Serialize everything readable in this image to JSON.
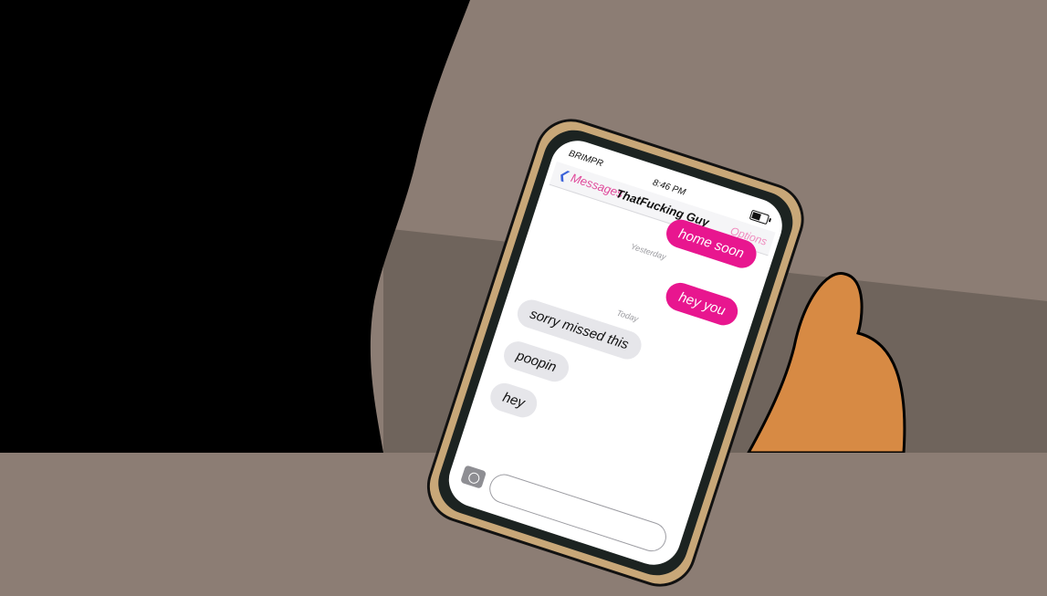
{
  "phone": {
    "carrier": "BRIMPR",
    "time": "8:46 PM",
    "nav": {
      "back_chevron": "❮",
      "back_label": "Messages",
      "contact_name": "ThatFucking Guy",
      "options_label": "Options"
    },
    "messages": [
      {
        "from": "me",
        "text": "home soon"
      },
      {
        "stamp": "Yesterday"
      },
      {
        "from": "me",
        "text": "hey you"
      },
      {
        "stamp": "Today"
      },
      {
        "from": "them",
        "text": "sorry missed this"
      },
      {
        "from": "them",
        "text": "poopin"
      },
      {
        "from": "them",
        "text": "hey"
      }
    ],
    "composer": {
      "placeholder": ""
    },
    "colors": {
      "outgoing_bubble": "#e8168f",
      "incoming_bubble": "#e6e6ea",
      "back_chevron": "#3b63d9",
      "options": "#f08cbf",
      "phone_frame": "#c8a778",
      "background_wall": "#8c7d74",
      "background_table": "#6f645c"
    }
  }
}
